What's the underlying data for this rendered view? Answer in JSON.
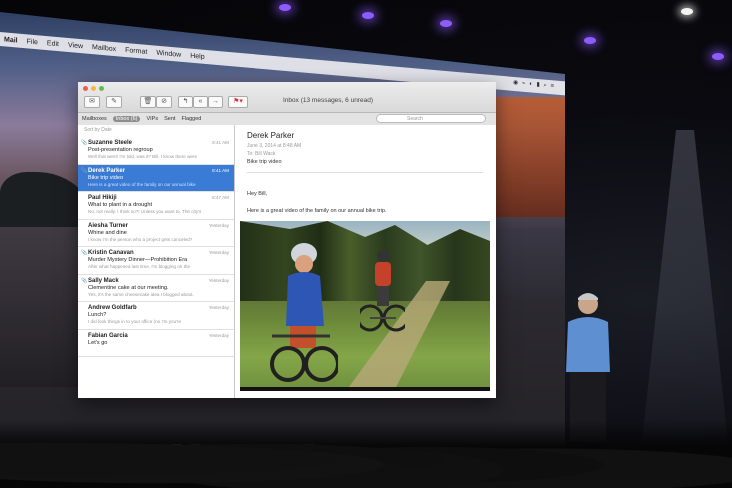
{
  "menubar": {
    "items": [
      "Mail",
      "File",
      "Edit",
      "View",
      "Mailbox",
      "Format",
      "Window",
      "Help"
    ]
  },
  "window": {
    "title": "Inbox (13 messages, 6 unread)",
    "favorites": {
      "mailboxes": "Mailboxes",
      "inbox": "Inbox (6)",
      "vips": "VIPs",
      "sent": "Sent",
      "flagged": "Flagged"
    },
    "search_placeholder": "Search",
    "sort_label": "Sort by Date"
  },
  "messages": [
    {
      "sender": "Suzanne Steele",
      "time": "9:41 AM",
      "subject": "Post-presentation regroup",
      "preview": "Well that went! I'm told, was it? Bill, I know there were",
      "has_attachment": true,
      "selected": false
    },
    {
      "sender": "Derek Parker",
      "time": "8:41 AM",
      "subject": "Bike trip video",
      "preview": "Here is a great video of the family on our annual bike",
      "has_attachment": true,
      "selected": true
    },
    {
      "sender": "Paul Hikiji",
      "time": "8:47 AM",
      "subject": "What to plant in a drought",
      "preview": "No, not really. I think so?! Unless you want to. The city's",
      "has_attachment": false,
      "selected": false
    },
    {
      "sender": "Aiesha Turner",
      "time": "Yesterday",
      "subject": "Whine and dine",
      "preview": "I know I'm the person who a project gets canceled?",
      "has_attachment": false,
      "selected": false
    },
    {
      "sender": "Kristin Canavan",
      "time": "Yesterday",
      "subject": "Murder Mystery Dinner—Prohibition Era",
      "preview": "After what happened last time, I'm blogging on the",
      "has_attachment": true,
      "selected": false
    },
    {
      "sender": "Sally Mack",
      "time": "Yesterday",
      "subject": "Clementine cake at our meeting.",
      "preview": "Yes, it's the same cheesecake idea I blogged about.",
      "has_attachment": true,
      "selected": false
    },
    {
      "sender": "Andrew Goldfarb",
      "time": "Yesterday",
      "subject": "Lunch?",
      "preview": "I did look things in to your office (no I'm you're",
      "has_attachment": false,
      "selected": false
    },
    {
      "sender": "Fabian Garcia",
      "time": "Yesterday",
      "subject": "Let's go",
      "preview": "",
      "has_attachment": false,
      "selected": false
    }
  ],
  "reader": {
    "from": "Derek Parker",
    "date": "June 3, 2014 at 8:48 AM",
    "to": "To: Bill Wack",
    "subject": "Bike trip video",
    "greeting": "Hey Bill,",
    "body": "Here is a great video of the family on our annual bike trip."
  },
  "colors": {
    "selection": "#3a7bd5",
    "stage_light": "#8c5cff"
  }
}
